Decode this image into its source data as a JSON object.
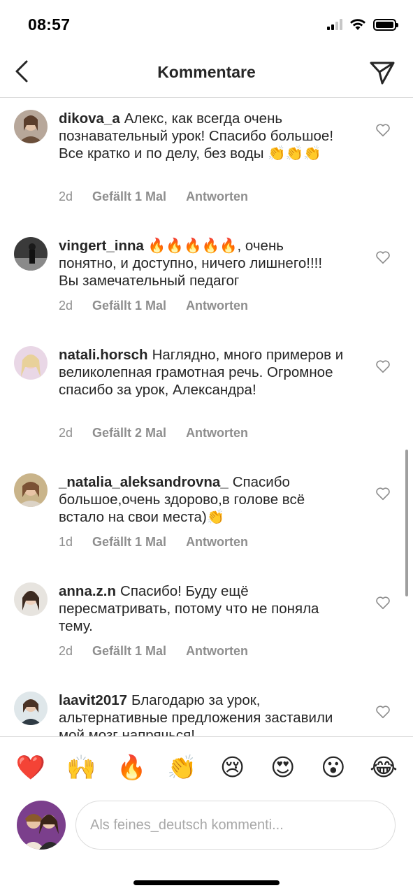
{
  "status": {
    "time": "08:57"
  },
  "nav": {
    "title": "Kommentare",
    "back_icon": "chevron-left-icon",
    "send_icon": "paper-plane-icon"
  },
  "comments": [
    {
      "username": "dikova_a",
      "text": "Алекс, как всегда очень познавательный урок! Спасибо большое! Все кратко и по делу, без воды 👏👏👏",
      "age": "2d",
      "likes": "Gefällt 1 Mal",
      "reply": "Antworten"
    },
    {
      "username": "vingert_inna",
      "text": "🔥🔥🔥🔥🔥, очень понятно, и доступно, ничего лишнего!!!! Вы замечательный педагог",
      "age": "2d",
      "likes": "Gefällt 1 Mal",
      "reply": "Antworten"
    },
    {
      "username": "natali.horsch",
      "text": "Наглядно, много примеров и великолепная грамотная речь. Огромное спасибо за урок, Александра!",
      "age": "2d",
      "likes": "Gefällt 2 Mal",
      "reply": "Antworten"
    },
    {
      "username": "_natalia_aleksandrovna_",
      "text": "Спасибо большое,очень здорово,в голове всё встало на свои места)👏",
      "age": "1d",
      "likes": "Gefällt 1 Mal",
      "reply": "Antworten"
    },
    {
      "username": "anna.z.n",
      "text": "Спасибо! Буду ещё пересматривать, потому что не поняла тему.",
      "age": "2d",
      "likes": "Gefällt 1 Mal",
      "reply": "Antworten"
    },
    {
      "username": "laavit2017",
      "text": "Благодарю за урок, альтернативные предложения заставили мой мозг напрячься!",
      "age": "",
      "likes": "",
      "reply": ""
    }
  ],
  "emoji_bar": [
    "❤️",
    "🙌",
    "🔥",
    "👏",
    "😢",
    "😍",
    "😮",
    "😂"
  ],
  "composer": {
    "placeholder": "Als feines_deutsch kommenti..."
  },
  "colors": {
    "text": "#262626",
    "secondary": "#8e8e8e",
    "divider": "#dbdbdb"
  }
}
